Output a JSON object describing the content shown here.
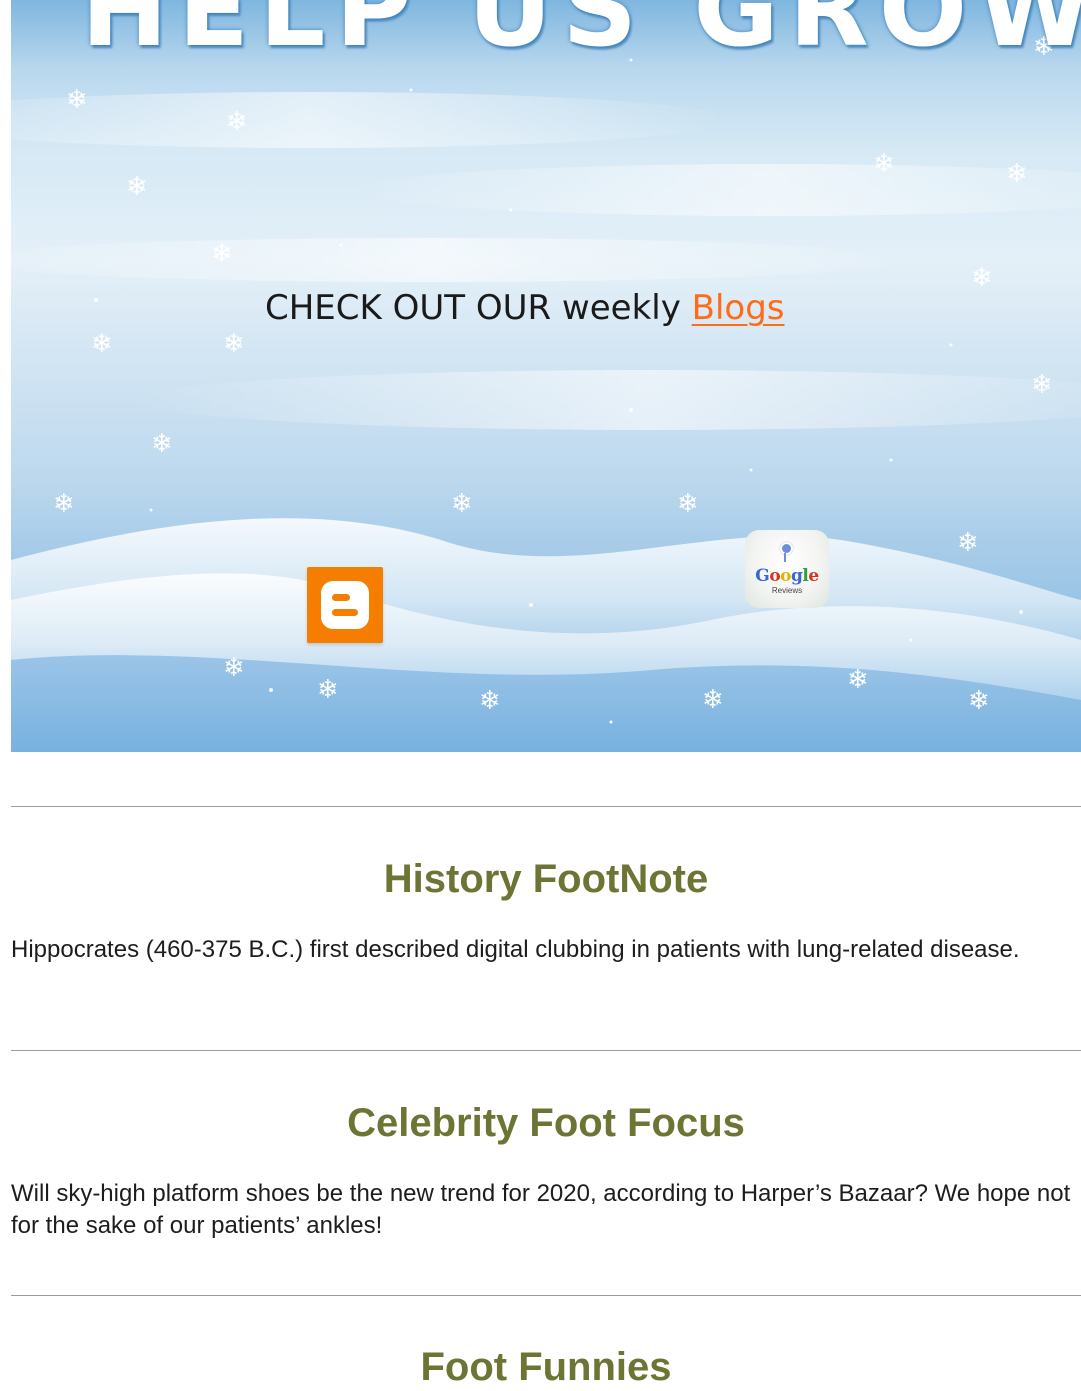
{
  "banner": {
    "headline": "HELP US GROW!",
    "cta_prefix": "CHECK OUT OUR weekly ",
    "cta_link": "Blogs",
    "google_badge_text": "Google",
    "google_badge_sub": "Reviews",
    "colors": {
      "cta_link": "#ff6b16",
      "blogger": "#f57d00"
    },
    "icons": [
      "blogger-icon",
      "google-reviews-icon",
      "snowflake-icon"
    ]
  },
  "sections": [
    {
      "title": "History FootNote",
      "body": "Hippocrates (460-375 B.C.) first described digital clubbing in patients with lung-related disease."
    },
    {
      "title": "Celebrity Foot Focus",
      "body": "Will sky-high platform shoes be the new trend for 2020, according to Harper’s Bazaar? We hope not for the sake of our patients’ ankles!"
    },
    {
      "title": "Foot Funnies",
      "body": ""
    }
  ],
  "colors": {
    "heading": "#6e7434",
    "divider": "#9b9b9b"
  }
}
